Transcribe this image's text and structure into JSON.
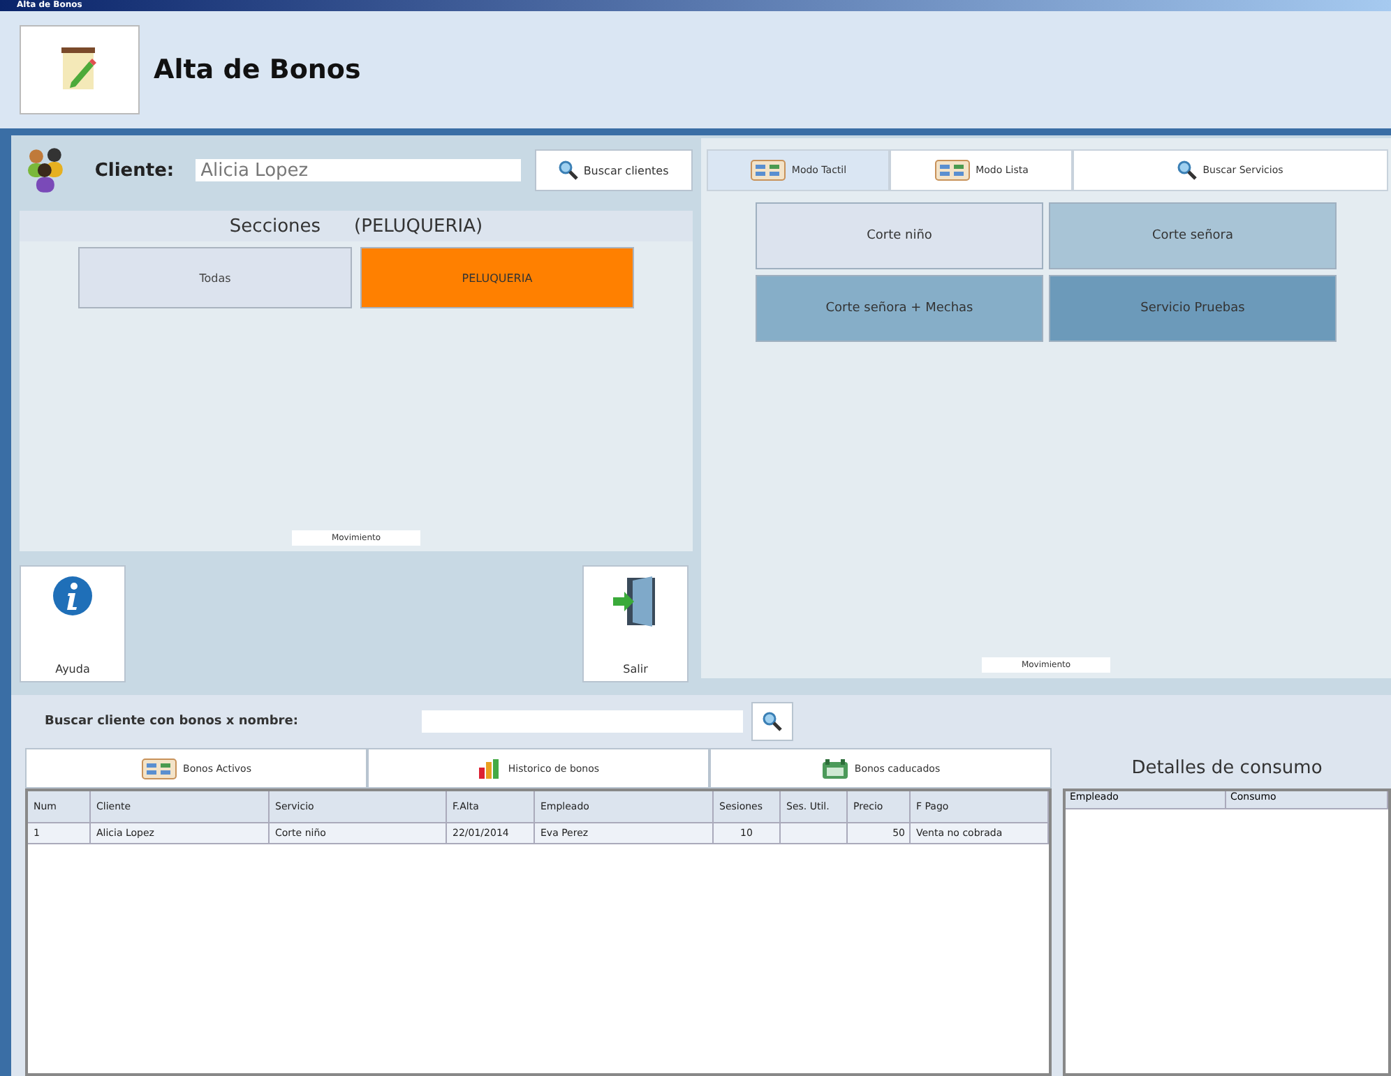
{
  "window": {
    "title": "Alta de Bonos"
  },
  "header": {
    "title": "Alta de Bonos"
  },
  "client": {
    "label": "Cliente:",
    "value": "Alicia Lopez",
    "search_button": "Buscar clientes"
  },
  "sections": {
    "title": "Secciones",
    "current": "(PELUQUERIA)",
    "items": [
      {
        "label": "Todas",
        "selected": false
      },
      {
        "label": "PELUQUERIA",
        "selected": true
      }
    ],
    "footer": "Movimiento"
  },
  "actions": [
    {
      "kind": "help",
      "label": "Ayuda"
    },
    {
      "kind": "exit",
      "label": "Salir"
    }
  ],
  "mode_tabs": [
    {
      "kind": "grid",
      "label": "Modo Tactil",
      "selected": true
    },
    {
      "kind": "grid",
      "label": "Modo Lista",
      "selected": false
    },
    {
      "kind": "search",
      "label": "Buscar Servicios",
      "selected": false
    }
  ],
  "services": {
    "items": [
      {
        "label": "Corte niño",
        "color": "#dce3ee"
      },
      {
        "label": "Corte señora",
        "color": "#a8c4d6"
      },
      {
        "label": "Corte señora + Mechas",
        "color": "#86aec8"
      },
      {
        "label": "Servicio Pruebas",
        "color": "#6c9aba"
      }
    ],
    "footer": "Movimiento"
  },
  "search_bonos": {
    "label": "Buscar cliente con bonos x nombre:"
  },
  "bono_tabs": [
    {
      "kind": "grid",
      "label": "Bonos Activos",
      "selected": false
    },
    {
      "kind": "chart",
      "label": "Historico de bonos",
      "selected": false
    },
    {
      "kind": "expired",
      "label": "Bonos caducados",
      "selected": false
    }
  ],
  "table": {
    "columns": [
      "Num",
      "Cliente",
      "Servicio",
      "F.Alta",
      "Empleado",
      "Sesiones",
      "Ses. Util.",
      "Precio",
      "F Pago"
    ],
    "rows": [
      [
        "1",
        "Alicia Lopez",
        "Corte niño",
        "22/01/2014",
        "Eva Perez",
        "10",
        "",
        "50",
        "Venta no cobrada"
      ]
    ]
  },
  "details": {
    "title": "Detalles de consumo",
    "columns": [
      "Empleado",
      "Consumo"
    ]
  }
}
